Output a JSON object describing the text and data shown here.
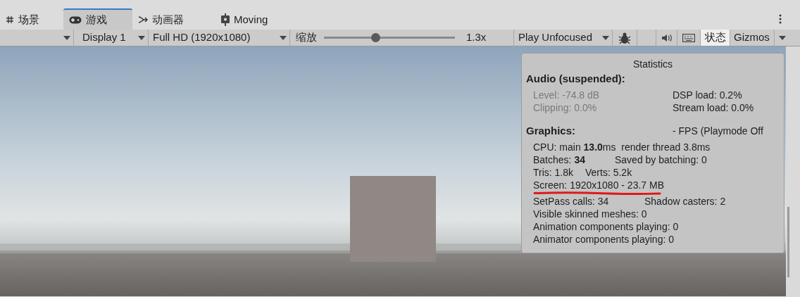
{
  "tabs": [
    {
      "label": "场景",
      "selected": false
    },
    {
      "label": "游戏",
      "selected": true
    },
    {
      "label": "动画器",
      "selected": false
    },
    {
      "label": "Moving",
      "selected": false
    }
  ],
  "toolbar": {
    "display": "Display 1",
    "resolution": "Full HD (1920x1080)",
    "scale_label": "缩放",
    "scale": {
      "level": 0.39
    },
    "scale_value": "1.3x",
    "play_mode": "Play Unfocused",
    "toggles": [
      {
        "kind": "bug",
        "selected": false
      },
      {
        "kind": "blank",
        "selected": false
      },
      {
        "kind": "audio",
        "selected": false
      },
      {
        "kind": "keyboard",
        "selected": false
      },
      {
        "kind": "text",
        "label": "状态",
        "selected": true
      }
    ],
    "gizmos": "Gizmos"
  },
  "statistics": {
    "title": "Statistics",
    "audio": {
      "heading": "Audio (suspended):",
      "rows": [
        {
          "left": "Level: -74.8 dB",
          "left_disabled": true,
          "right": "DSP load: 0.2%"
        },
        {
          "left": "Clipping: 0.0%",
          "left_disabled": true,
          "right": "Stream load: 0.0%"
        }
      ]
    },
    "graphics": {
      "heading": "Graphics:",
      "fps": "- FPS (Playmode Off",
      "lines": [
        {
          "left": "CPU: main **13.0**ms  render thread 3.8ms"
        },
        {
          "left": "Batches: **34**",
          "right": "Saved by batching: 0"
        },
        {
          "left": "Tris: 1.8k",
          "right": "Verts: 5.2k"
        },
        {
          "left": "Screen: 1920x1080 - 23.7 MB"
        },
        {
          "left": "SetPass calls: 34",
          "right": "Shadow casters: 2"
        },
        {
          "left": "Visible skinned meshes: 0"
        },
        {
          "left": "Animation components playing: 0"
        },
        {
          "left": "Animator components playing: 0"
        }
      ]
    }
  }
}
